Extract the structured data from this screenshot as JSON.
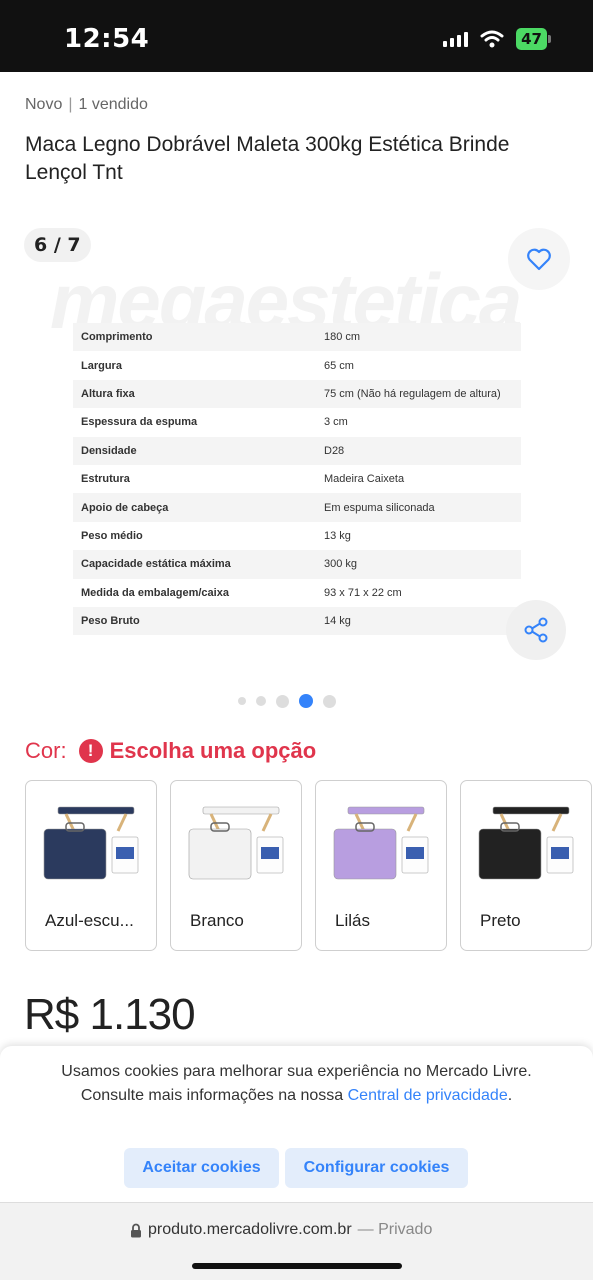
{
  "status_bar": {
    "time": "12:54",
    "battery": "47"
  },
  "product": {
    "condition": "Novo",
    "separator": "|",
    "sold": "1 vendido",
    "title": "Maca Legno Dobrável Maleta 300kg Estética Brinde Lençol Tnt"
  },
  "gallery": {
    "counter": "6 / 7",
    "watermark": "megaestetica",
    "active_index": 3,
    "total_dots": 5,
    "specs": [
      {
        "key": "Comprimento",
        "value": "180 cm"
      },
      {
        "key": "Largura",
        "value": "65 cm"
      },
      {
        "key": "Altura fixa",
        "value": "75 cm (Não há regulagem de altura)"
      },
      {
        "key": "Espessura da espuma",
        "value": "3 cm"
      },
      {
        "key": "Densidade",
        "value": "D28"
      },
      {
        "key": "Estrutura",
        "value": "Madeira Caixeta"
      },
      {
        "key": "Apoio de cabeça",
        "value": "Em espuma siliconada"
      },
      {
        "key": "Peso médio",
        "value": "13 kg"
      },
      {
        "key": "Capacidade estática máxima",
        "value": "300 kg"
      },
      {
        "key": "Medida da embalagem/caixa",
        "value": "93 x 71 x 22 cm"
      },
      {
        "key": "Peso Bruto",
        "value": "14 kg"
      }
    ]
  },
  "color_picker": {
    "label": "Cor:",
    "alert_icon": "!",
    "message": "Escolha uma opção",
    "options": [
      {
        "label": "Azul-escu...",
        "color": "#2b3a5e"
      },
      {
        "label": "Branco",
        "color": "#f2f2f2"
      },
      {
        "label": "Lilás",
        "color": "#b89ee0"
      },
      {
        "label": "Preto",
        "color": "#222222"
      }
    ]
  },
  "price": "R$ 1.130",
  "cookie_banner": {
    "text": "Usamos cookies para melhorar sua experiência no Mercado Livre. Consulte mais informações na nossa ",
    "link": "Central de privacidade",
    "end": ".",
    "accept": "Aceitar cookies",
    "configure": "Configurar cookies"
  },
  "browser": {
    "url": "produto.mercadolivre.com.br",
    "privacy": "— Privado"
  },
  "colors": {
    "accent": "#3483fa",
    "error": "#e0354c"
  }
}
